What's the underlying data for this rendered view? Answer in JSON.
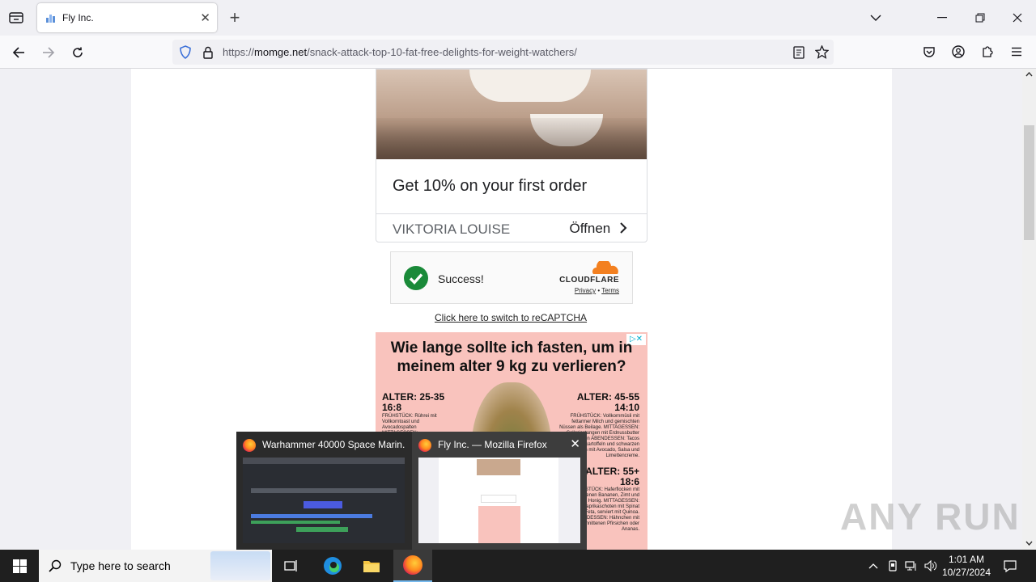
{
  "browser": {
    "tab_title": "Fly Inc.",
    "new_tab_symbol": "+",
    "url_prefix": "https://",
    "url_host": "momge.net",
    "url_path": "/snack-attack-top-10-fat-free-delights-for-weight-watchers/"
  },
  "page": {
    "ad1": {
      "headline": "Get 10% on your first order",
      "brand": "VIKTORIA LOUISE",
      "cta": "Öffnen"
    },
    "captcha": {
      "status": "Success!",
      "provider": "CLOUDFLARE",
      "privacy": "Privacy",
      "separator": "•",
      "terms": "Terms",
      "switch_link": "Click here to switch to reCAPTCHA"
    },
    "ad2": {
      "title": "Wie lange sollte ich fasten, um in meinem alter 9 kg zu verlieren?",
      "left_age": "ALTER: 25-35",
      "left_ratio": "16:8",
      "right_age": "ALTER: 45-55",
      "right_ratio": "14:10",
      "right2_age": "ALTER: 55+",
      "right2_ratio": "18:6",
      "left_text": "FRÜHSTÜCK: Rührei mit Vollkorntoast und Avocadospalten MITTAGESSEN:",
      "right_text": "FRÜHSTÜCK: Vollkornmüsli mit fettarmer Milch und gemischten Nüssen als Beilage. MITTAGESSEN: Selleriestangen mit Erdnussbutter und Rosinen ABENDESSEN: Tacos aus Süßkartoffeln und schwarzen Bohnen mit Avocado, Salsa und Limettencreme.",
      "right2_text": "FRÜHSTÜCK: Haferflocken mit geschnittenen Bananen, Zimt und etwas Honig. MITTAGESSEN: Gefüllte Paprikaschoten mit Spinat und Feta, serviert mit Quinoa. ABENDESSEN: Hähnchen mit geschnittenen Pfirsichen oder Ananas."
    }
  },
  "taskbar_preview": {
    "items": [
      {
        "title": "Warhammer 40000 Space Marin..."
      },
      {
        "title": "Fly Inc. — Mozilla Firefox"
      }
    ]
  },
  "watermark": "ANY RUN",
  "taskbar": {
    "search_placeholder": "Type here to search",
    "time": "1:01 AM",
    "date": "10/27/2024"
  },
  "colors": {
    "accent_blue": "#0060df",
    "cf_green": "#1a8a39",
    "cf_orange": "#f38020",
    "ad_pink": "#f9c3bd"
  }
}
